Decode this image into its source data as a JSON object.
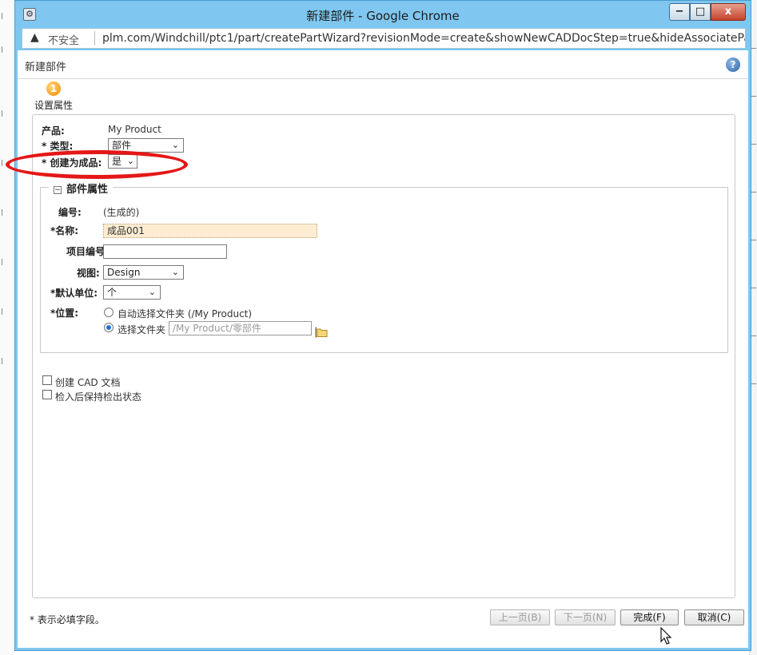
{
  "window": {
    "title": "新建部件 - Google Chrome",
    "min_glyph": "−",
    "max_glyph": "□",
    "close_glyph": "x"
  },
  "address_bar": {
    "security_label": "不安全",
    "url": "plm.com/Windchill/ptc1/part/createPartWizard?revisionMode=create&showNewCADDocStep=true&hideAssociatePa..."
  },
  "page": {
    "title": "新建部件",
    "help_glyph": "?",
    "step_label": "设置属性",
    "step_glyph": "1"
  },
  "form": {
    "product_label": "产品:",
    "product_value": "My Product",
    "type_label": "* 类型:",
    "type_value": "部件",
    "finished_label": "* 创建为成品:",
    "finished_value": "是"
  },
  "part_attributes": {
    "legend": "部件属性",
    "number_label": "编号:",
    "number_value": "(生成的)",
    "name_label": "名称:",
    "name_value": "成品001",
    "project_label": "项目编号:",
    "project_value": "",
    "view_label": "视图:",
    "view_value": "Design",
    "unit_label": "默认单位:",
    "unit_value": "个",
    "location_label": "位置:",
    "location_auto": "自动选择文件夹 (/My Product)",
    "location_choose": "选择文件夹",
    "location_path": "/My Product/零部件"
  },
  "options": {
    "create_cad": "创建 CAD 文档",
    "keep_checked_out": "检入后保持检出状态"
  },
  "footer": {
    "required_note": "* 表示必填字段。",
    "prev_button": "上一页(B)",
    "next_button": "下一页(N)",
    "finish_button": "完成(F)",
    "cancel_button": "取消(C)"
  },
  "colors": {
    "title_bar": "#7fc7f0",
    "annotation": "#e51717",
    "highlight_field": "#fdecd2",
    "radio_selected": "#1e6fd8"
  },
  "icons": {
    "warning": "warning-triangle-icon",
    "help": "help-icon",
    "step": "step-number-icon",
    "folder": "folder-icon",
    "cursor": "mouse-cursor-icon"
  }
}
